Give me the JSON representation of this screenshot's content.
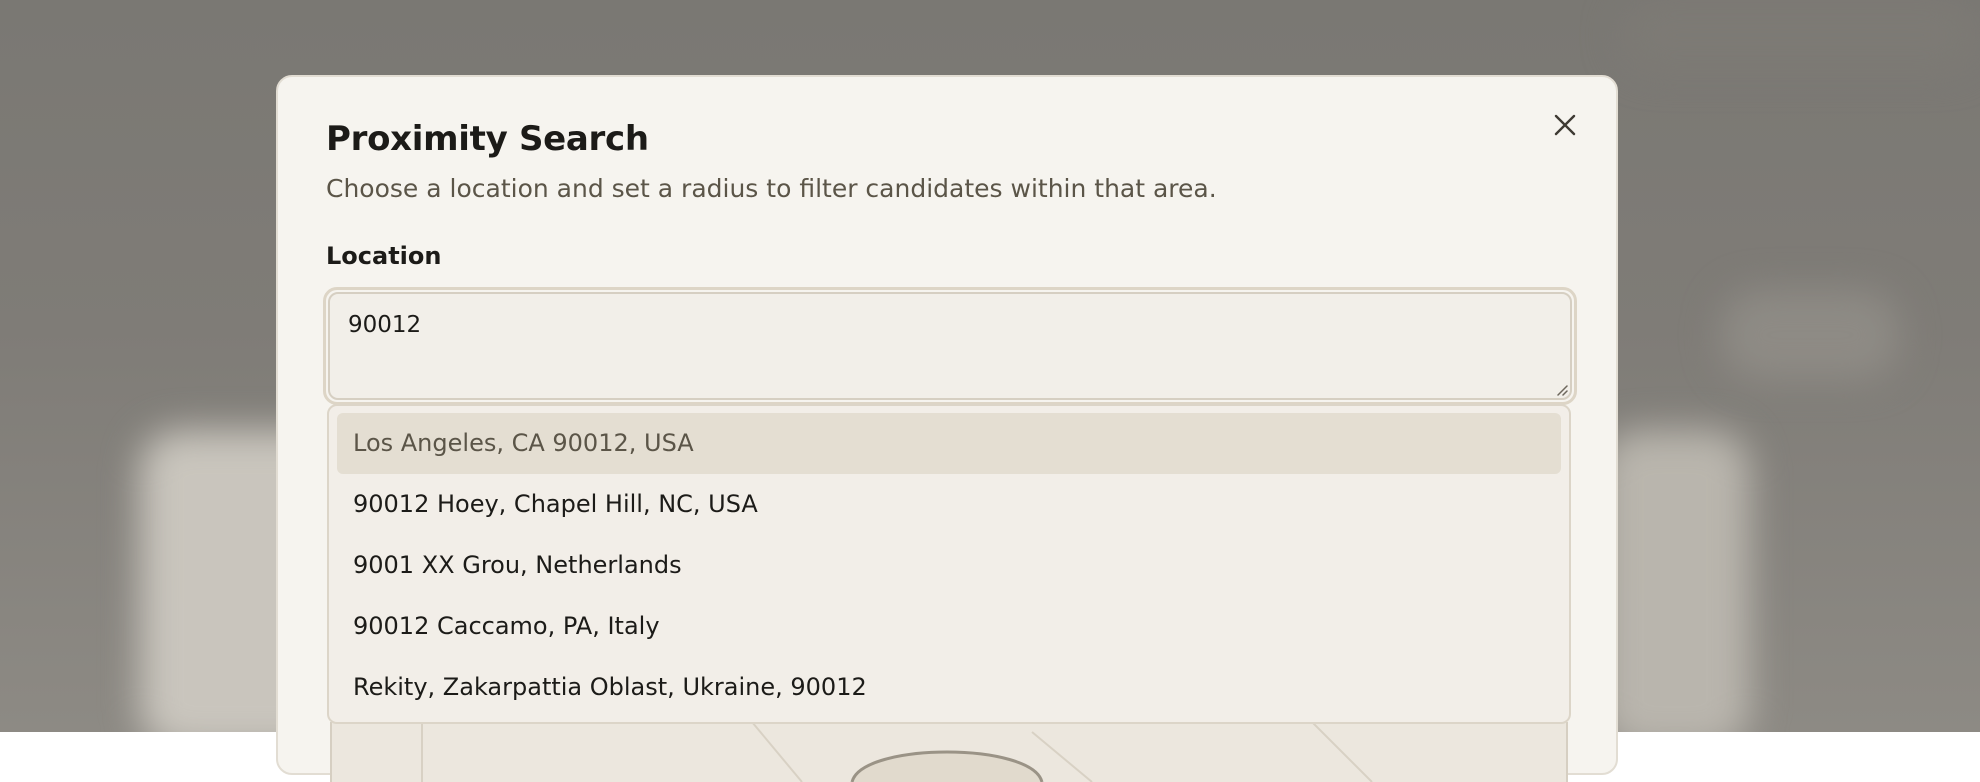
{
  "modal": {
    "title": "Proximity Search",
    "description": "Choose a location and set a radius to filter candidates within that area.",
    "location_label": "Location",
    "location_value": "90012",
    "suggestions": [
      "Los Angeles, CA 90012, USA",
      "90012 Hoey, Chapel Hill, NC, USA",
      "9001 XX Grou, Netherlands",
      "90012 Caccamo, PA, Italy",
      "Rekity, Zakarpattia Oblast, Ukraine, 90012"
    ],
    "active_suggestion_index": 0
  },
  "icons": {
    "close": "close-icon",
    "resize": "resize-handle-icon"
  },
  "colors": {
    "modal_bg": "#f6f4ef",
    "backdrop": "#7a7873",
    "active_item_bg": "#e4ded2",
    "text_primary": "#1c1b18",
    "text_secondary": "#5b5548"
  }
}
